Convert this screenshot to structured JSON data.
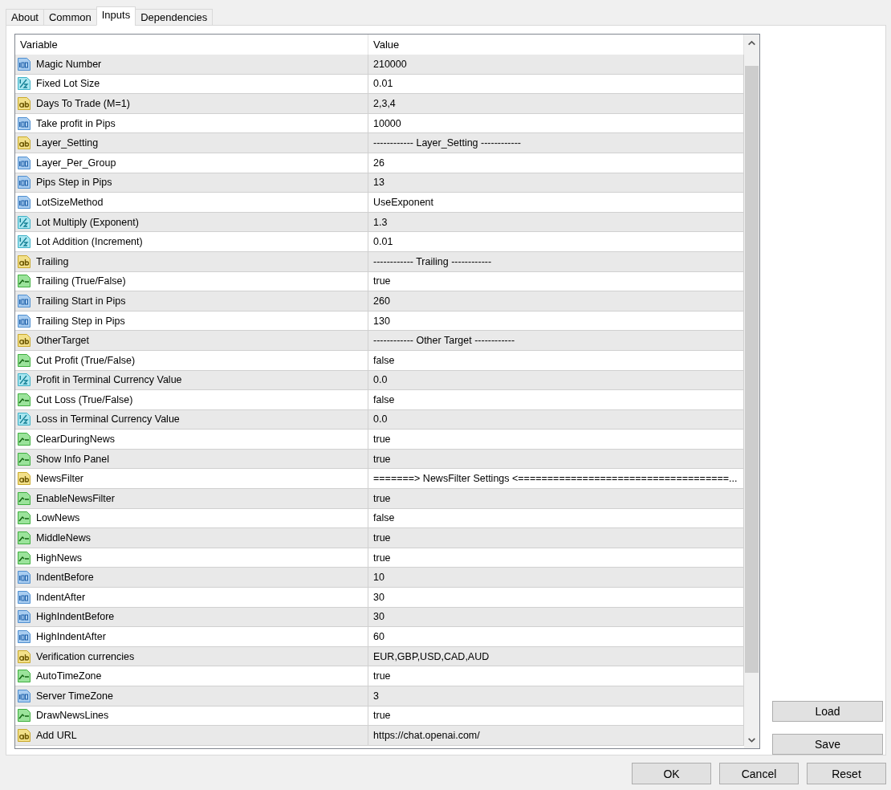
{
  "tabs": [
    {
      "label": "About",
      "selected": false
    },
    {
      "label": "Common",
      "selected": false
    },
    {
      "label": "Inputs",
      "selected": true
    },
    {
      "label": "Dependencies",
      "selected": false
    }
  ],
  "table": {
    "columns": [
      "Variable",
      "Value"
    ],
    "rows": [
      {
        "kind": "int",
        "variable": "Magic Number",
        "value": "210000"
      },
      {
        "kind": "double",
        "variable": "Fixed Lot Size",
        "value": "0.01"
      },
      {
        "kind": "string",
        "variable": "Days To Trade (M=1)",
        "value": "2,3,4"
      },
      {
        "kind": "int",
        "variable": "Take profit in Pips",
        "value": "10000"
      },
      {
        "kind": "string",
        "variable": "Layer_Setting",
        "value": "------------ Layer_Setting ------------"
      },
      {
        "kind": "int",
        "variable": "Layer_Per_Group",
        "value": "26"
      },
      {
        "kind": "int",
        "variable": "Pips Step in Pips",
        "value": "13"
      },
      {
        "kind": "int",
        "variable": "LotSizeMethod",
        "value": "UseExponent"
      },
      {
        "kind": "double",
        "variable": "Lot Multiply (Exponent)",
        "value": "1.3"
      },
      {
        "kind": "double",
        "variable": "Lot Addition (Increment)",
        "value": "0.01"
      },
      {
        "kind": "string",
        "variable": "Trailing",
        "value": "------------ Trailing ------------"
      },
      {
        "kind": "bool",
        "variable": "Trailing (True/False)",
        "value": "true"
      },
      {
        "kind": "int",
        "variable": "Trailing Start in Pips",
        "value": "260"
      },
      {
        "kind": "int",
        "variable": "Trailing Step in Pips",
        "value": "130"
      },
      {
        "kind": "string",
        "variable": "OtherTarget",
        "value": "------------ Other Target ------------"
      },
      {
        "kind": "bool",
        "variable": "Cut Profit (True/False)",
        "value": "false"
      },
      {
        "kind": "double",
        "variable": "Profit in Terminal Currency Value",
        "value": "0.0"
      },
      {
        "kind": "bool",
        "variable": "Cut Loss (True/False)",
        "value": "false"
      },
      {
        "kind": "double",
        "variable": "Loss in Terminal Currency Value",
        "value": "0.0"
      },
      {
        "kind": "bool",
        "variable": "ClearDuringNews",
        "value": "true"
      },
      {
        "kind": "bool",
        "variable": "Show Info Panel",
        "value": "true"
      },
      {
        "kind": "string",
        "variable": "NewsFilter",
        "value": "=======>  NewsFilter Settings <====================================..."
      },
      {
        "kind": "bool",
        "variable": "EnableNewsFilter",
        "value": "true"
      },
      {
        "kind": "bool",
        "variable": "LowNews",
        "value": "false"
      },
      {
        "kind": "bool",
        "variable": "MiddleNews",
        "value": "true"
      },
      {
        "kind": "bool",
        "variable": "HighNews",
        "value": "true"
      },
      {
        "kind": "int",
        "variable": "IndentBefore",
        "value": "10"
      },
      {
        "kind": "int",
        "variable": "IndentAfter",
        "value": "30"
      },
      {
        "kind": "int",
        "variable": "HighIndentBefore",
        "value": "30"
      },
      {
        "kind": "int",
        "variable": "HighIndentAfter",
        "value": "60"
      },
      {
        "kind": "string",
        "variable": "Verification currencies",
        "value": "EUR,GBP,USD,CAD,AUD"
      },
      {
        "kind": "bool",
        "variable": "AutoTimeZone",
        "value": "true"
      },
      {
        "kind": "int",
        "variable": "Server TimeZone",
        "value": "3"
      },
      {
        "kind": "bool",
        "variable": "DrawNewsLines",
        "value": "true"
      },
      {
        "kind": "string",
        "variable": "Add URL",
        "value": "https://chat.openai.com/"
      }
    ]
  },
  "side_buttons": [
    "Load",
    "Save"
  ],
  "buttons": [
    "OK",
    "Cancel",
    "Reset"
  ]
}
